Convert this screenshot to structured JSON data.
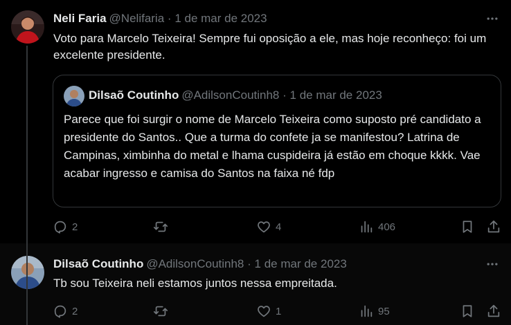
{
  "tweet1": {
    "author_name": "Neli Faria",
    "handle": "@Nelifaria",
    "date": "1 de mar de 2023",
    "text": "Voto para Marcelo Teixeira! Sempre fui oposição a ele, mas hoje reconheço: foi um excelente presidente.",
    "quote": {
      "author_name": "Dilsaõ Coutinho",
      "handle": "@AdilsonCoutinh8",
      "date": "1 de mar de 2023",
      "text": "Parece que foi surgir o nome de Marcelo Teixeira como suposto pré candidato a presidente do Santos.. Que a turma do confete ja se manifestou? Latrina de Campinas, ximbinha do metal e lhama cuspideira já estão em choque kkkk. Vae acabar ingresso e camisa do Santos na faixa né fdp"
    },
    "replies": "2",
    "retweets": "",
    "likes": "4",
    "views": "406"
  },
  "tweet2": {
    "author_name": "Dilsaõ Coutinho",
    "handle": "@AdilsonCoutinh8",
    "date": "1 de mar de 2023",
    "text": "Tb sou Teixeira neli estamos juntos nessa empreitada.",
    "replies": "2",
    "retweets": "",
    "likes": "1",
    "views": "95"
  },
  "separator": "·",
  "icons": {
    "more": "more-horizontal-icon",
    "reply": "reply-icon",
    "retweet": "retweet-icon",
    "like": "heart-icon",
    "views": "views-chart-icon",
    "bookmark": "bookmark-icon",
    "share": "share-icon"
  },
  "colors": {
    "background": "#000000",
    "text_primary": "#e7e9ea",
    "text_secondary": "#71767b",
    "border": "#333639"
  }
}
